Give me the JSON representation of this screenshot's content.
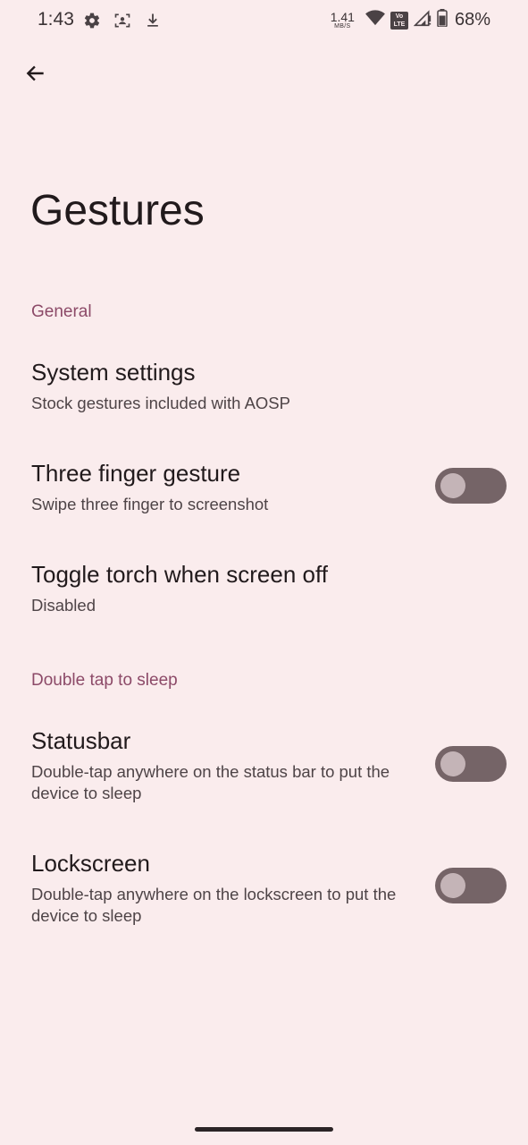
{
  "status_bar": {
    "time": "1:43",
    "net_speed_value": "1.41",
    "net_speed_unit": "MB/S",
    "volte_top": "Vo",
    "volte_bottom": "LTE",
    "battery_percent": "68%",
    "icons": [
      "gear-icon",
      "face-scan-icon",
      "download-icon",
      "wifi-icon",
      "volte-icon",
      "signal-icon",
      "battery-icon"
    ]
  },
  "page": {
    "title": "Gestures"
  },
  "sections": {
    "general": {
      "header": "General",
      "items": [
        {
          "title": "System settings",
          "summary": "Stock gestures included with AOSP"
        },
        {
          "title": "Three finger gesture",
          "summary": "Swipe three finger to screenshot",
          "switch_on": false
        },
        {
          "title": "Toggle torch when screen off",
          "summary": "Disabled"
        }
      ]
    },
    "double_tap": {
      "header": "Double tap to sleep",
      "items": [
        {
          "title": "Statusbar",
          "summary": "Double-tap anywhere on the status bar to put the device to sleep",
          "switch_on": false
        },
        {
          "title": "Lockscreen",
          "summary": "Double-tap anywhere on the lockscreen to put the device to sleep",
          "switch_on": false
        }
      ]
    }
  },
  "colors": {
    "background": "#faeced",
    "accent": "#8c4a68",
    "switch_track_off": "#756467",
    "switch_thumb_off": "#c4b4b7"
  }
}
